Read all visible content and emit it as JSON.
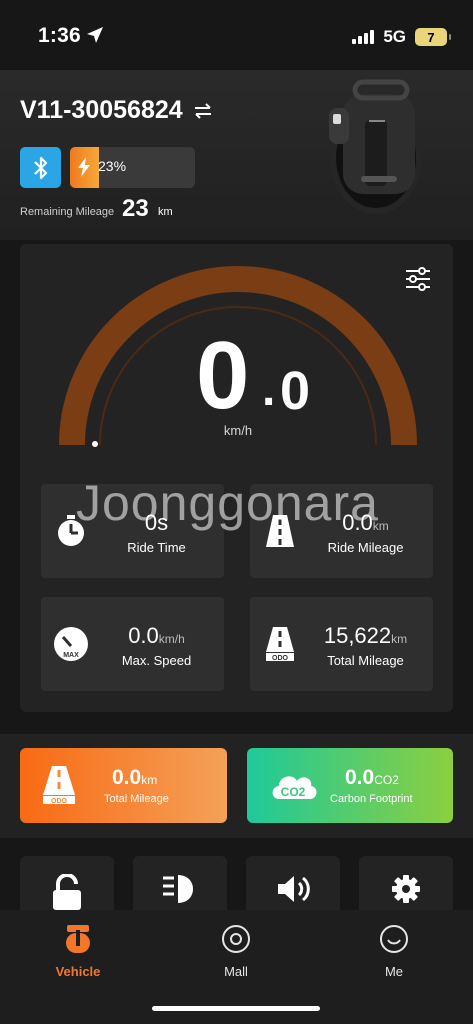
{
  "status_bar": {
    "time": "1:36",
    "network": "5G",
    "battery": "7"
  },
  "vehicle": {
    "id": "V11-30056824",
    "battery_percent_text": "23%",
    "battery_level": 0.23,
    "remaining_label": "Remaining Mileage",
    "remaining_value": "23",
    "remaining_unit": "km"
  },
  "speed": {
    "integer": "0",
    "decimal": "0",
    "unit": "km/h",
    "gauge_level": 0
  },
  "stats": {
    "ride_time": {
      "value": "0s",
      "unit": "",
      "label": "Ride Time",
      "icon": "stopwatch-icon"
    },
    "ride_mileage": {
      "value": "0.0",
      "unit": "km",
      "label": "Ride Mileage",
      "icon": "road-icon"
    },
    "max_speed": {
      "value": "0.0",
      "unit": "km/h",
      "label": "Max. Speed",
      "icon": "max-speedometer-icon",
      "icon_text": "MAX"
    },
    "total_mileage": {
      "value": "15,622",
      "unit": "km",
      "label": "Total Mileage",
      "icon": "odo-road-icon",
      "icon_text": "ODO"
    }
  },
  "watermark": "Joonggonara",
  "eco": {
    "mileage": {
      "value": "0.0",
      "unit": "km",
      "label": "Total Mileage",
      "icon_text": "ODO"
    },
    "carbon": {
      "value": "0.0",
      "unit": "CO2",
      "label": "Carbon Footprint",
      "icon_text": "CO2"
    }
  },
  "quick_actions": [
    "lock-icon",
    "headlight-icon",
    "horn-icon",
    "gear-icon"
  ],
  "tabs": [
    {
      "label": "Vehicle",
      "active": true
    },
    {
      "label": "Mall",
      "active": false
    },
    {
      "label": "Me",
      "active": false
    }
  ],
  "colors": {
    "accent": "#f4762a",
    "bluetooth": "#2aa6e6",
    "gauge": "#7a3d14",
    "eco_orange": "#f86a14",
    "eco_green": "#1ec99a"
  }
}
